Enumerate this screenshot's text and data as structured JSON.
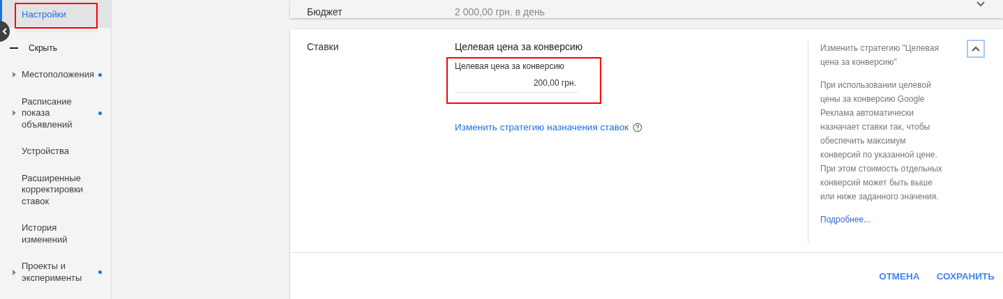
{
  "sidebar": {
    "selected_item": {
      "label": "Настройки",
      "selected": true,
      "highlighted": true
    },
    "collapse_label": "Скрыть",
    "items": [
      {
        "label": "Местоположения",
        "has_children": true,
        "modified": true
      },
      {
        "label": "Расписание показа объявлений",
        "has_children": true,
        "modified": true
      },
      {
        "label": "Устройства",
        "has_children": false,
        "modified": false
      },
      {
        "label": "Расширенные корректировки ставок",
        "has_children": false,
        "modified": false
      },
      {
        "label": "История изменений",
        "has_children": false,
        "modified": false
      },
      {
        "label": "Проекты и эксперименты",
        "has_children": true,
        "modified": true
      }
    ]
  },
  "budget": {
    "label": "Бюджет",
    "value": "2 000,00 грн. в день"
  },
  "bids": {
    "label": "Ставки",
    "strategy": "Целевая цена за конверсию",
    "field": {
      "label": "Целевая цена за конверсию",
      "value": "200,00 грн.",
      "highlighted": true
    },
    "change_link": "Изменить стратегию назначения ставок",
    "help": {
      "expanded": true,
      "title": "Изменить стратегию \"Целевая цена за конверсию\"",
      "text": "При использовании целевой цены за конверсию Google Реклама автоматически назначает ставки так, чтобы обеспечить максимум конверсий по указанной цене. При этом стоимость отдельных конверсий может быть выше или ниже заданного значения.",
      "link": "Подробнее..."
    },
    "buttons": [
      "ОТМЕНА",
      "СОХРАНИТЬ"
    ]
  }
}
